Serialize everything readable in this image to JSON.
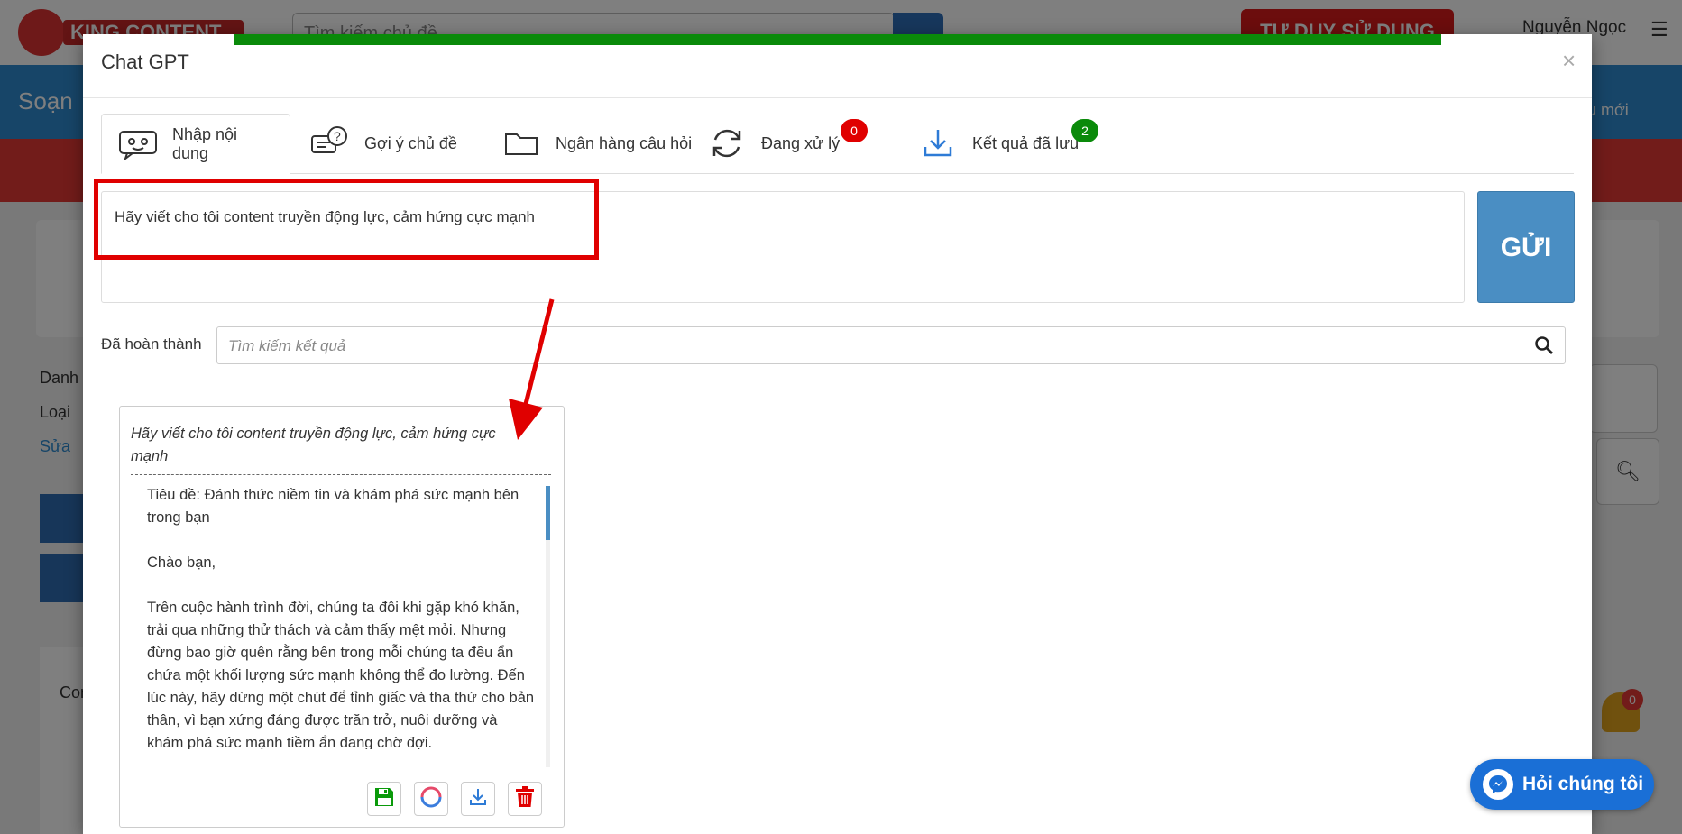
{
  "background": {
    "search_placeholder": "Tìm kiếm chủ đề",
    "cta_label": "TƯ DUY SỬ DỤNG",
    "user_name": "Nguyễn Ngọc",
    "nav_title": "Soạn",
    "nav_right": "u mới",
    "side_items": [
      "Danh",
      "Loại",
      "Sửa"
    ],
    "card_text": "Con",
    "notification_count": "0"
  },
  "modal": {
    "title": "Chat GPT",
    "close": "×",
    "tabs": [
      {
        "label": "Nhập nội dung",
        "icon": "chat-bot-icon",
        "active": true
      },
      {
        "label": "Gợi ý chủ đề",
        "icon": "question-chat-icon"
      },
      {
        "label": "Ngân hàng câu hỏi",
        "icon": "folder-icon"
      },
      {
        "label": "Đang xử lý",
        "icon": "refresh-icon",
        "badge": "0",
        "badge_color": "#e00000"
      },
      {
        "label": "Kết quả đã lưu",
        "icon": "download-icon",
        "badge": "2",
        "badge_color": "#0a8a0a"
      }
    ],
    "prompt": "Hãy viết cho tôi content truyền động lực, cảm hứng cực mạnh",
    "send_label": "GỬI",
    "filter_label": "Đã hoàn thành",
    "search_placeholder": "Tìm kiếm kết quả",
    "result": {
      "question": "Hãy viết cho tôi content truyền động lực, cảm hứng cực mạnh",
      "paragraphs": [
        "Tiêu đề: Đánh thức niềm tin và khám phá sức mạnh bên trong bạn",
        "Chào bạn,",
        "Trên cuộc hành trình đời, chúng ta đôi khi gặp khó khăn, trải qua những thử thách và cảm thấy mệt mỏi. Nhưng đừng bao giờ quên rằng bên trong mỗi chúng ta đều ẩn chứa một khối lượng sức mạnh không thể đo lường. Đến lúc này, hãy dừng một chút để tỉnh giấc và tha thứ cho bản thân, vì bạn xứng đáng được trăn trở, nuôi dưỡng và khám phá sức mạnh tiềm ẩn đang chờ đợi."
      ]
    }
  },
  "colors": {
    "accent_blue": "#4a8ec3",
    "annotation_red": "#e00000",
    "save_green": "#0a9a0a",
    "delete_red": "#e00000",
    "progress_green": "#0a8a0a"
  },
  "chat_widget": {
    "label": "Hỏi chúng tôi",
    "icon": "messenger-icon"
  }
}
